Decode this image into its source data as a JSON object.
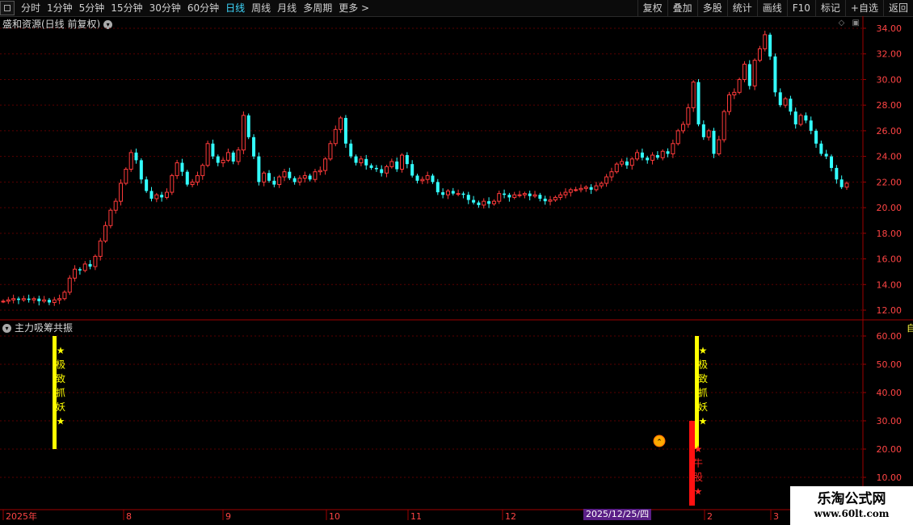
{
  "toolbar": {
    "periods": [
      "分时",
      "1分钟",
      "5分钟",
      "15分钟",
      "30分钟",
      "60分钟",
      "日线",
      "周线",
      "月线",
      "多周期",
      "更多 >"
    ],
    "active_period": "日线",
    "actions": [
      "复权",
      "叠加",
      "多股",
      "统计",
      "画线",
      "F10",
      "标记",
      "+自选",
      "返回"
    ]
  },
  "main_panel": {
    "title": "盛和资源(日线 前复权)",
    "y_ticks": [
      "34.00",
      "32.00",
      "30.00",
      "28.00",
      "26.00",
      "24.00",
      "22.00",
      "20.00",
      "18.00",
      "16.00",
      "14.00",
      "12.00"
    ]
  },
  "indicator_panel": {
    "title": "主力吸筹共振",
    "y_ticks": [
      "60.00",
      "50.00",
      "40.00",
      "30.00",
      "20.00",
      "10.00"
    ],
    "signal_text": "★极致抓妖★",
    "red_signal_text": "★牛股★"
  },
  "x_axis": {
    "labels": [
      "2025年",
      "8",
      "9",
      "10",
      "11",
      "12",
      "2",
      "3"
    ],
    "highlight_date": "2025/12/25/四"
  },
  "watermark": {
    "title": "乐淘公式网",
    "url": "www.60lt.com"
  },
  "colors": {
    "up": "#ff3a3a",
    "down": "#33ffff",
    "yellow": "#ffff00",
    "grid": "#5a0000",
    "axis": "#a00000"
  },
  "chart_data": {
    "type": "candlestick",
    "y_range": [
      11.0,
      35.5
    ],
    "closes": [
      12.7,
      12.8,
      12.9,
      12.8,
      12.9,
      12.8,
      12.9,
      12.7,
      12.8,
      12.6,
      12.8,
      12.9,
      13.4,
      14.5,
      15.2,
      15.1,
      15.6,
      15.4,
      16.2,
      17.4,
      18.6,
      19.8,
      20.5,
      21.9,
      23.0,
      24.3,
      23.7,
      22.2,
      21.3,
      20.7,
      21.0,
      20.8,
      21.2,
      22.5,
      23.5,
      22.8,
      21.8,
      22.0,
      22.5,
      23.3,
      25.0,
      24.0,
      23.5,
      23.7,
      24.3,
      23.6,
      24.5,
      27.2,
      25.5,
      24.0,
      22.0,
      22.7,
      22.1,
      21.8,
      22.4,
      22.8,
      22.3,
      22.0,
      22.3,
      22.5,
      22.2,
      22.8,
      22.9,
      23.8,
      25.0,
      26.1,
      27.0,
      25.0,
      24.0,
      23.5,
      23.8,
      23.3,
      23.1,
      23.0,
      22.7,
      23.2,
      23.6,
      23.0,
      24.1,
      23.4,
      22.5,
      22.1,
      22.2,
      22.5,
      22.0,
      21.2,
      21.0,
      21.3,
      21.1,
      21.1,
      21.0,
      20.6,
      20.4,
      20.2,
      20.5,
      20.3,
      20.5,
      21.1,
      21.0,
      20.8,
      21.0,
      21.0,
      21.1,
      20.9,
      21.0,
      20.7,
      20.5,
      20.6,
      20.8,
      21.0,
      21.2,
      21.4,
      21.4,
      21.5,
      21.6,
      21.4,
      21.7,
      21.9,
      22.4,
      22.8,
      23.4,
      23.6,
      23.3,
      23.8,
      24.3,
      23.9,
      23.7,
      24.1,
      23.9,
      24.4,
      24.2,
      25.0,
      26.0,
      26.5,
      27.8,
      29.8,
      26.5,
      25.5,
      26.0,
      24.2,
      25.3,
      27.5,
      28.8,
      29.0,
      30.0,
      31.2,
      29.5,
      31.5,
      32.4,
      33.5,
      31.8,
      29.0,
      28.0,
      28.5,
      27.5,
      26.5,
      27.2,
      26.8,
      26.0,
      25.0,
      24.2,
      24.0,
      23.1,
      22.2,
      21.6,
      21.9
    ],
    "signal_bars": [
      {
        "position": "early 2025 (Jul)",
        "value_top": 60,
        "value_bottom": 20,
        "label": "★极致抓妖★"
      },
      {
        "position": "late Jan 2026",
        "value_top": 60,
        "value_bottom": 20,
        "label": "★极致抓妖★"
      },
      {
        "position": "late Jan 2026",
        "value_top": 30,
        "value_bottom": 0,
        "label": "★牛股★",
        "color": "red"
      }
    ]
  }
}
